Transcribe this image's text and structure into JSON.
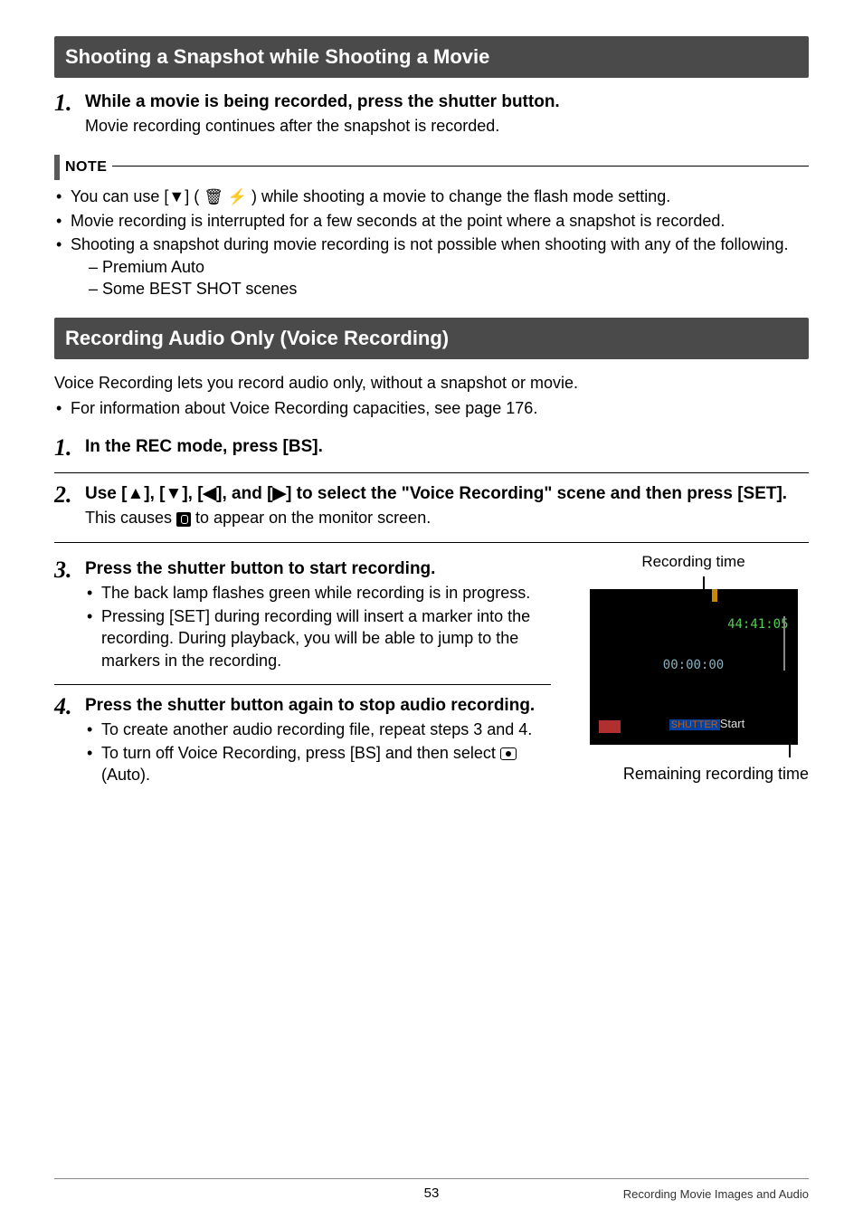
{
  "section1": {
    "title": "Shooting a Snapshot while Shooting a Movie",
    "step1": {
      "num": "1.",
      "title": "While a movie is being recorded, press the shutter button.",
      "body": "Movie recording continues after the snapshot is recorded."
    },
    "note_label": "NOTE",
    "notes": {
      "n1a": "You can use [",
      "n1b": "] ( ",
      "n1c": " ) while shooting a movie to change the flash mode setting.",
      "n2": "Movie recording is interrupted for a few seconds at the point where a snapshot is recorded.",
      "n3": "Shooting a snapshot during movie recording is not possible when shooting with any of the following.",
      "n3a": "Premium Auto",
      "n3b": "Some BEST SHOT scenes"
    }
  },
  "section2": {
    "title": "Recording Audio Only (Voice Recording)",
    "intro1": "Voice Recording lets you record audio only, without a snapshot or movie.",
    "intro2": "For information about Voice Recording capacities, see page 176.",
    "step1": {
      "num": "1.",
      "title": "In the REC mode, press [BS]."
    },
    "step2": {
      "num": "2.",
      "title_a": "Use [",
      "title_b": "], [",
      "title_c": "], [",
      "title_d": "], and [",
      "title_e": "] to select the \"Voice Recording\" scene and then press [SET].",
      "body_a": "This causes ",
      "body_b": " to appear on the monitor screen."
    },
    "step3": {
      "num": "3.",
      "title": "Press the shutter button to start recording.",
      "b1": "The back lamp flashes green while recording is in progress.",
      "b2": "Pressing [SET] during recording will insert a marker into the recording. During playback, you will be able to jump to the markers in the recording."
    },
    "step4": {
      "num": "4.",
      "title": "Press the shutter button again to stop audio recording.",
      "b1": "To create another audio recording file, repeat steps 3 and 4.",
      "b2a": "To turn off Voice Recording, press [BS] and then select ",
      "b2b": " (Auto)."
    },
    "image": {
      "rec_time_label": "Recording time",
      "toptime": "44:41:05",
      "midtime": "00:00:00",
      "shutter": "SHUTTER",
      "start": "Start",
      "remain_label": "Remaining recording time"
    }
  },
  "footer": {
    "page": "53",
    "section": "Recording Movie Images and Audio"
  },
  "glyphs": {
    "down": "▼",
    "up": "▲",
    "left": "◀",
    "right": "▶",
    "trash": "🗑",
    "flash": "⚡"
  }
}
